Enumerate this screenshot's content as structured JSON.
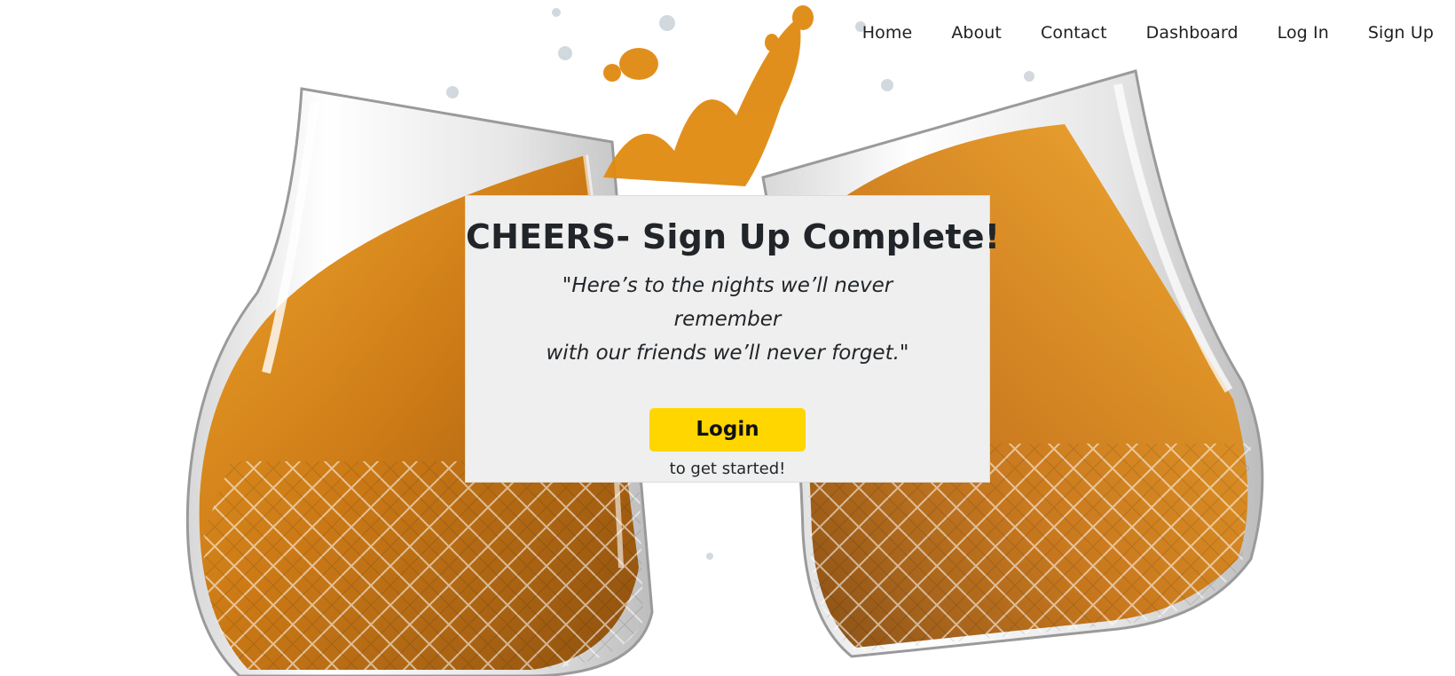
{
  "nav": {
    "items": [
      {
        "label": "Home"
      },
      {
        "label": "About"
      },
      {
        "label": "Contact"
      },
      {
        "label": "Dashboard"
      },
      {
        "label": "Log In"
      },
      {
        "label": "Sign Up"
      }
    ]
  },
  "card": {
    "title": "CHEERS- Sign Up Complete!",
    "quote_line1": "\"Here’s to the nights we’ll never remember",
    "quote_line2": "with our friends we’ll never forget.\"",
    "login_label": "Login",
    "subtext": "to get started!"
  },
  "background": {
    "image_name": "whiskey-glasses-cheers-image"
  },
  "colors": {
    "button": "#ffd600",
    "card_bg": "#efefef",
    "whiskey": "#c8720a"
  }
}
